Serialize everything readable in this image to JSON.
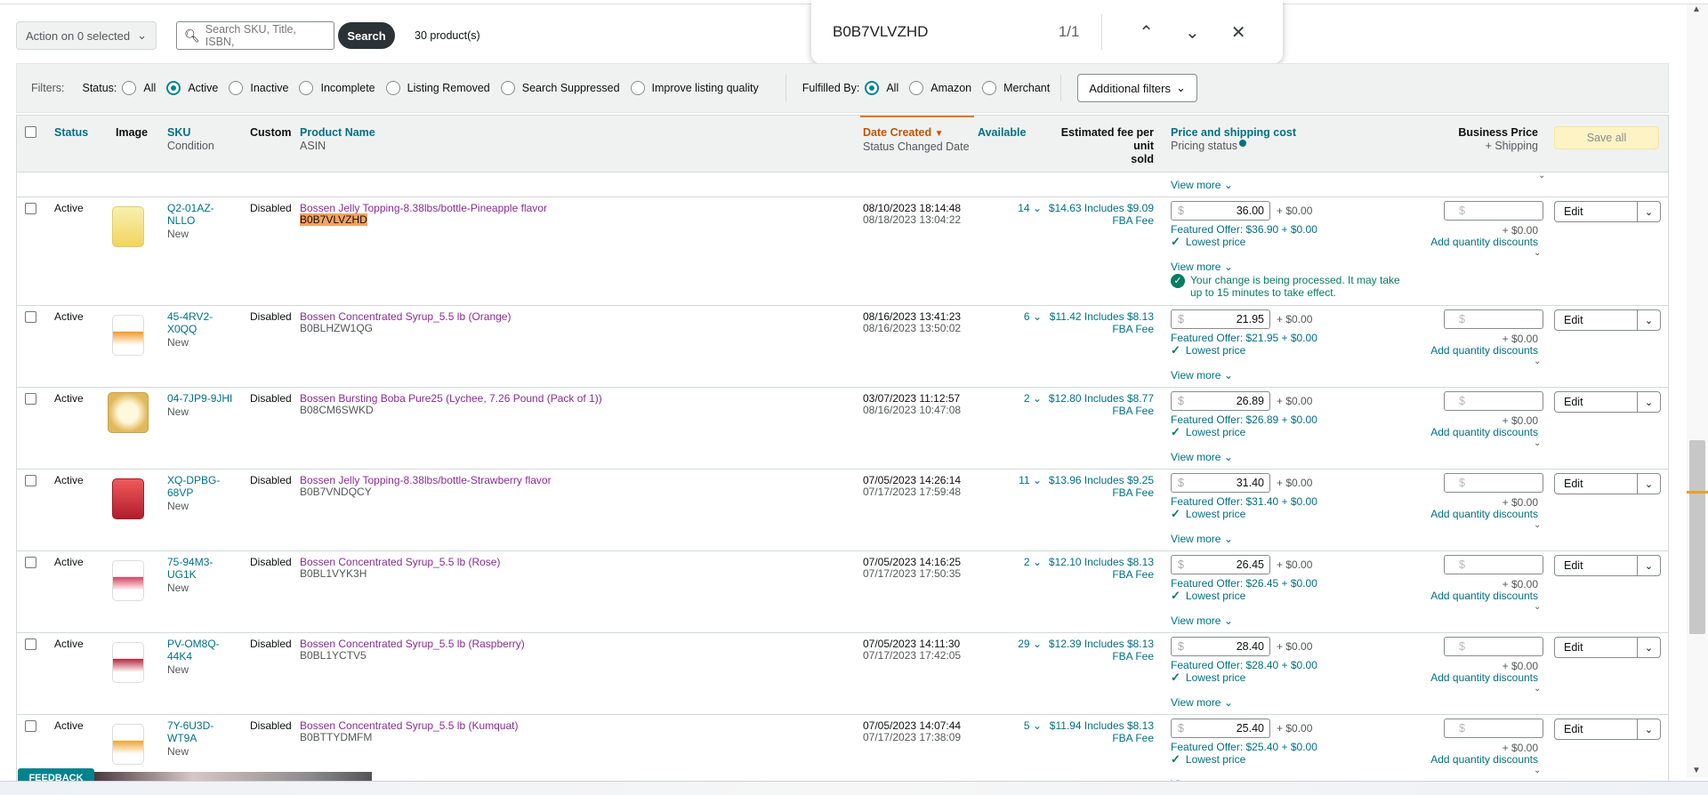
{
  "toolbar": {
    "action_label": "Action on 0 selected",
    "search_placeholder": "Search SKU, Title, ISBN,",
    "search_button": "Search",
    "product_count": "30 product(s)"
  },
  "findbar": {
    "query": "B0B7VLVZHD",
    "count": "1/1"
  },
  "filters": {
    "label": "Filters:",
    "status_label": "Status:",
    "status_options": [
      "All",
      "Active",
      "Inactive",
      "Incomplete",
      "Listing Removed",
      "Search Suppressed",
      "Improve listing quality"
    ],
    "status_selected": "Active",
    "fulfilled_label": "Fulfilled By:",
    "fulfilled_options": [
      "All",
      "Amazon",
      "Merchant"
    ],
    "fulfilled_selected": "All",
    "additional_filters": "Additional filters"
  },
  "table_header": {
    "status": "Status",
    "image": "Image",
    "sku": "SKU",
    "condition": "Condition",
    "custom": "Custom",
    "product_name": "Product Name",
    "asin": "ASIN",
    "date_created": "Date Created",
    "status_changed": "Status Changed Date",
    "available": "Available",
    "fee_line1": "Estimated fee per unit",
    "fee_line2": "sold",
    "price_shipping": "Price and shipping cost",
    "pricing_status": "Pricing status",
    "business_price": "Business Price",
    "plus_shipping": "+ Shipping",
    "save_all": "Save all"
  },
  "common": {
    "view_more": "View more",
    "shipping": "+ $0.00",
    "lowest_price": "Lowest price",
    "add_qty": "Add quantity discounts",
    "edit": "Edit",
    "dollar": "$",
    "condition": "New",
    "custom": "Disabled",
    "status": "Active",
    "fba_fee": "FBA Fee",
    "processing_msg_1": "Your change is being processed. It may take",
    "processing_msg_2": "up to 15 minutes to take effect."
  },
  "rows": [
    {
      "sku1": "Q2-01AZ-",
      "sku2": "NLLO",
      "name": "Bossen Jelly Topping-8.38lbs/bottle-Pineapple flavor",
      "asin": "B0B7VLVZHD",
      "created": "08/10/2023 18:14:48",
      "changed": "08/18/2023 13:04:22",
      "available": "14",
      "fee": "$14.63 Includes $9.09",
      "price": "36.00",
      "featured": "Featured Offer: $36.90 + $0.00"
    },
    {
      "sku1": "45-4RV2-",
      "sku2": "X0QQ",
      "name": "Bossen Concentrated Syrup_5.5 lb (Orange)",
      "asin": "B0BLHZW1QG",
      "created": "08/16/2023 13:41:23",
      "changed": "08/16/2023 13:50:02",
      "available": "6",
      "fee": "$11.42 Includes $8.13",
      "price": "21.95",
      "featured": "Featured Offer: $21.95 + $0.00"
    },
    {
      "sku1": "04-7JP9-9JHI",
      "sku2": "",
      "name": "Bossen Bursting Boba Pure25 (Lychee, 7.26 Pound (Pack of 1))",
      "asin": "B08CM6SWKD",
      "created": "03/07/2023 11:12:57",
      "changed": "08/16/2023 10:47:08",
      "available": "2",
      "fee": "$12.80 Includes $8.77",
      "price": "26.89",
      "featured": "Featured Offer: $26.89 + $0.00"
    },
    {
      "sku1": "XQ-DPBG-",
      "sku2": "68VP",
      "name": "Bossen Jelly Topping-8.38lbs/bottle-Strawberry flavor",
      "asin": "B0B7VNDQCY",
      "created": "07/05/2023 14:26:14",
      "changed": "07/17/2023 17:59:48",
      "available": "11",
      "fee": "$13.96 Includes $9.25",
      "price": "31.40",
      "featured": "Featured Offer: $31.40 + $0.00"
    },
    {
      "sku1": "75-94M3-",
      "sku2": "UG1K",
      "name": "Bossen Concentrated Syrup_5.5 lb (Rose)",
      "asin": "B0BL1VYK3H",
      "created": "07/05/2023 14:16:25",
      "changed": "07/17/2023 17:50:35",
      "available": "2",
      "fee": "$12.10 Includes $8.13",
      "price": "26.45",
      "featured": "Featured Offer: $26.45 + $0.00"
    },
    {
      "sku1": "PV-OM8Q-",
      "sku2": "44K4",
      "name": "Bossen Concentrated Syrup_5.5 lb (Raspberry)",
      "asin": "B0BL1YCTV5",
      "created": "07/05/2023 14:11:30",
      "changed": "07/17/2023 17:42:05",
      "available": "29",
      "fee": "$12.39 Includes $8.13",
      "price": "28.40",
      "featured": "Featured Offer: $28.40 + $0.00"
    },
    {
      "sku1": "7Y-6U3D-",
      "sku2": "WT9A",
      "name": "Bossen Concentrated Syrup_5.5 lb (Kumquat)",
      "asin": "B0BTTYDMFM",
      "created": "07/05/2023 14:07:44",
      "changed": "07/17/2023 17:38:09",
      "available": "5",
      "fee": "$11.94 Includes $8.13",
      "price": "25.40",
      "featured": "Featured Offer: $25.40 + $0.00"
    }
  ],
  "feedback": "FEEDBACK",
  "colors": {
    "teal": "#007185",
    "purple": "#8a2c95",
    "highlight": "#f4a261",
    "sort_orange": "#c45500",
    "success": "#067d62"
  }
}
